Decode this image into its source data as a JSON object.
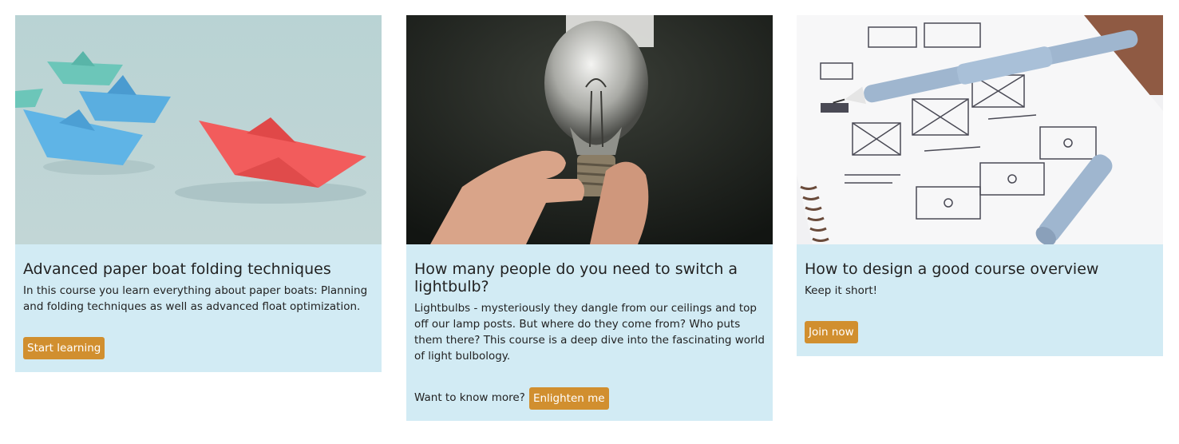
{
  "cards": [
    {
      "title": "Advanced paper boat folding techniques",
      "description": "In this course you learn everything about paper boats: Planning and folding techniques as well as advanced float optimization.",
      "cta_prefix": "",
      "button_label": "Start learning",
      "image_icon": "paper-boats-image"
    },
    {
      "title": "How many people do you need to switch a lightbulb?",
      "description": "Lightbulbs - mysteriously they dangle from our ceilings and top off our lamp posts. But where do they come from? Who puts them there? This course is a deep dive into the fascinating world of light bulbology.",
      "cta_prefix": "Want to know more?",
      "button_label": "Enlighten me",
      "image_icon": "lightbulb-image"
    },
    {
      "title": "How to design a good course overview",
      "description": "Keep it short!",
      "cta_prefix": "",
      "button_label": "Join now",
      "image_icon": "wireframe-sketch-image"
    }
  ],
  "colors": {
    "card_background": "#d2ebf4",
    "button_background": "#d18f2f",
    "button_text": "#ffffff"
  }
}
